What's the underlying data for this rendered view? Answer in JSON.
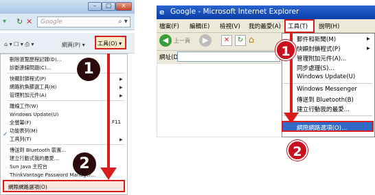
{
  "left": {
    "search_placeholder": "Google",
    "window_buttons": {
      "minimize": "–",
      "maximize": "□",
      "close": "×"
    },
    "command_bar": {
      "feeds": "⌂ ▾ ☐ ▾ ⎙ ▾",
      "page": "網頁(P) ▾",
      "tools": "工具(O) ▾"
    },
    "menu_items": [
      "刪除瀏覽歷程記錄(D)...",
      "診斷連線問題(C)...",
      "快顯封鎖程式(P)",
      "網路釣魚篩選工具(H)",
      "管理附加元件(A)",
      "離線工作(W)",
      "Windows Update(U)",
      "全螢幕(F)",
      "功能表列(M)",
      "工具列(T)",
      "傳送到 Bluetooth 裝置...",
      "建立行動式我的最愛...",
      "Sun Java 主控台",
      "ThinkVantage Password Manager..."
    ],
    "fullscreen_shortcut": "F11",
    "options_item": "網際網路選項(O)",
    "check_mark": "✓"
  },
  "right": {
    "window_title": "Google - Microsoft Internet Explorer",
    "menubar": [
      "檔案(F)",
      "編輯(E)",
      "檢視(V)",
      "我的最愛(A)",
      "工具(T)",
      "說明(H)"
    ],
    "back_label": "上一頁",
    "address_label": "網址(D)",
    "menu_items": [
      "郵件和新聞(M)",
      "快顯封鎖程式(P)",
      "管理附加元件(A)...",
      "同步處理(S)...",
      "Windows Update(U)",
      "Windows Messenger",
      "傳送到 Bluetooth(B)",
      "建立行動我的最愛..."
    ],
    "options_item": "網際網路選項(O)..."
  },
  "badges": {
    "step1": "1",
    "step2": "2"
  },
  "colors": {
    "highlight_red": "#d91c1c",
    "badge_red": "#c8101e",
    "ie6_title_blue": "#0a3ea9",
    "selected_blue": "#316ac5"
  }
}
